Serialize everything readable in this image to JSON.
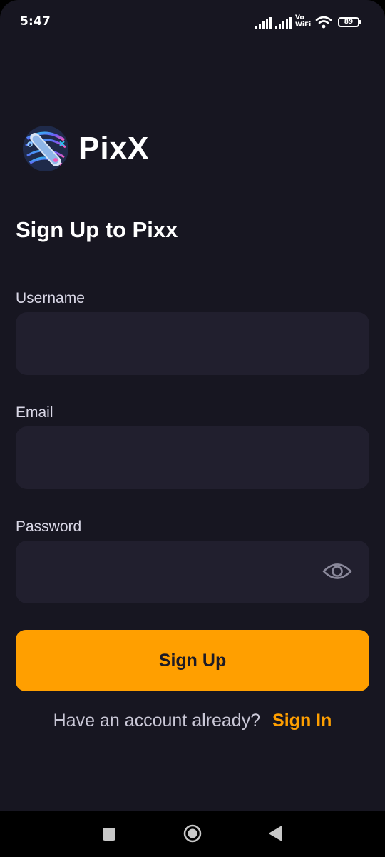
{
  "status_bar": {
    "time": "5:47",
    "vowifi_top": "Vo",
    "vowifi_bottom": "WiFi",
    "battery": "89"
  },
  "brand": {
    "name": "PixX"
  },
  "form": {
    "title": "Sign Up to Pixx",
    "username_label": "Username",
    "username_value": "",
    "email_label": "Email",
    "email_value": "",
    "password_label": "Password",
    "password_value": "",
    "submit_label": "Sign Up"
  },
  "footer": {
    "prompt": "Have an account already?",
    "link": "Sign In"
  },
  "colors": {
    "background": "#171621",
    "field_background": "#211f2e",
    "accent": "#ff9f00"
  },
  "icons": {
    "password_toggle": "eye-icon",
    "nav_recents": "square-icon",
    "nav_home": "circle-icon",
    "nav_back": "triangle-back-icon"
  }
}
